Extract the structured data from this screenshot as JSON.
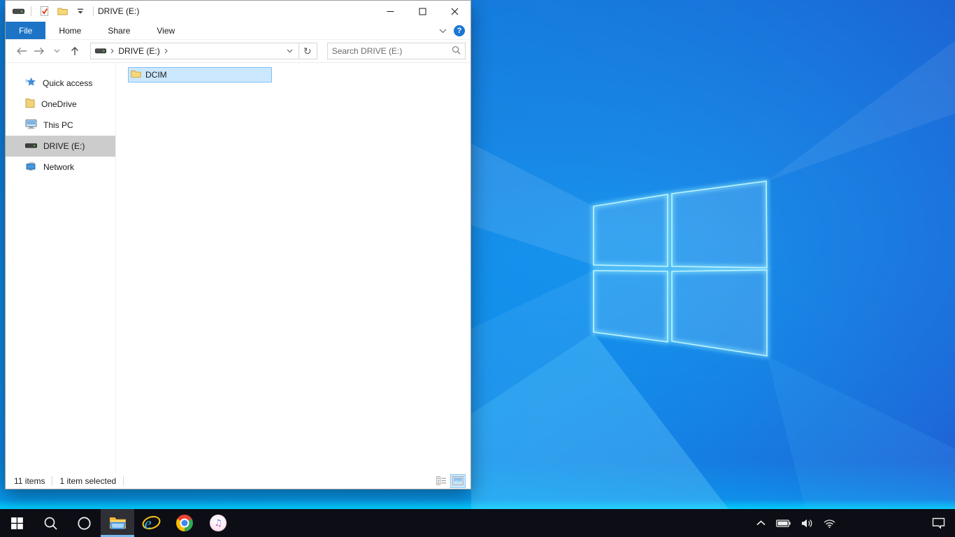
{
  "window": {
    "title": "DRIVE (E:)",
    "qat_icons": [
      "drive-icon",
      "properties-check-icon",
      "new-folder-icon",
      "customize-qat-chevron"
    ],
    "ribbon": {
      "tabs": [
        "File",
        "Home",
        "Share",
        "View"
      ],
      "help_glyph": "?"
    },
    "nav": {
      "breadcrumb_crumb": "DRIVE (E:)",
      "search_placeholder": "Search DRIVE (E:)"
    },
    "sidebar": {
      "items": [
        {
          "icon": "quick-access-star",
          "label": "Quick access"
        },
        {
          "icon": "onedrive-folder",
          "label": "OneDrive"
        },
        {
          "icon": "this-pc-monitor",
          "label": "This PC"
        },
        {
          "icon": "drive",
          "label": "DRIVE (E:)",
          "selected": true
        },
        {
          "icon": "network",
          "label": "Network"
        }
      ]
    },
    "files": [
      {
        "icon": "folder",
        "name": "DCIM",
        "selected": true
      }
    ],
    "status": {
      "items_count": "11 items",
      "selection": "1 item selected"
    }
  },
  "taskbar": {
    "apps": [
      "start",
      "search",
      "cortana",
      "file-explorer",
      "internet-explorer",
      "chrome",
      "itunes"
    ],
    "active_app": "file-explorer",
    "tray": [
      "hidden-icons-chevron",
      "battery",
      "volume",
      "wifi",
      "action-center"
    ]
  },
  "colors": {
    "accent_blue": "#1d74c6",
    "selection_fill": "#cce8ff",
    "selection_border": "#7fc1f7",
    "sidebar_selected": "#cccccc",
    "taskbar_bg": "#0d0d15",
    "taskbar_underline": "#76b9ed",
    "wallpaper_top_right": "#2144ca",
    "wallpaper_mid": "#1077d6",
    "wallpaper_glow": "#35c8ff"
  }
}
